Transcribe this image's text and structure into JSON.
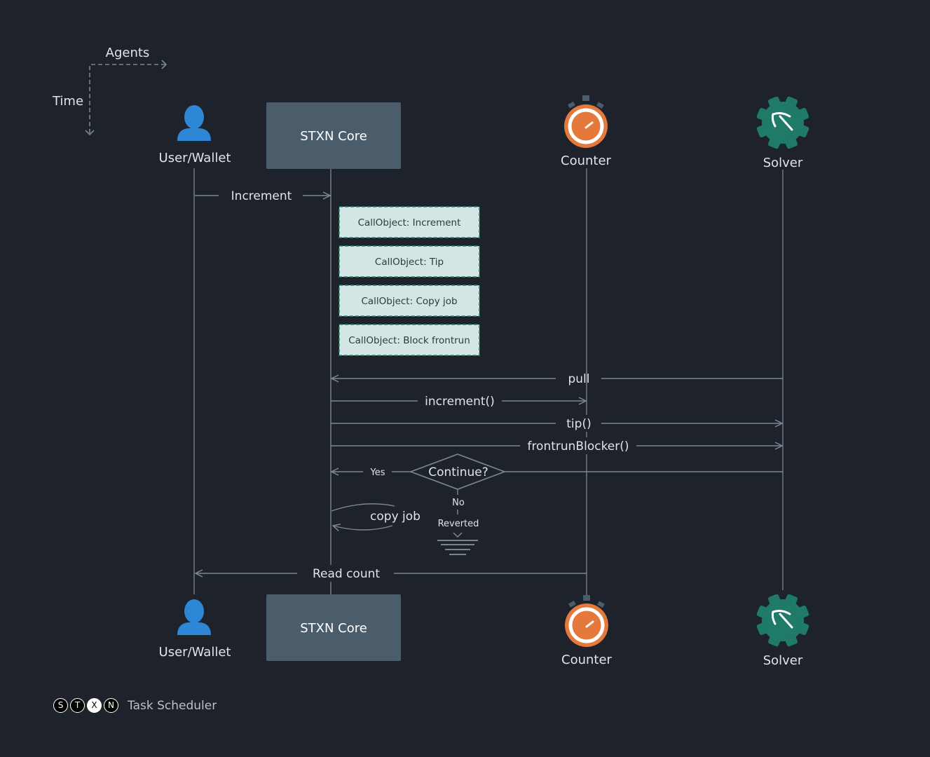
{
  "axes": {
    "horizontal_label": "Agents",
    "vertical_label": "Time"
  },
  "actors": {
    "user": "User/Wallet",
    "core": "STXN Core",
    "counter": "Counter",
    "solver": "Solver"
  },
  "call_objects": [
    "CallObject: Increment",
    "CallObject: Tip",
    "CallObject: Copy job",
    "CallObject: Block frontrun"
  ],
  "messages": {
    "increment": "Increment",
    "pull": "pull",
    "increment_call": "increment()",
    "tip_call": "tip()",
    "frontrun_call": "frontrunBlocker()",
    "decision": "Continue?",
    "yes": "Yes",
    "no": "No",
    "reverted": "Reverted",
    "copy_job": "copy job",
    "read_count": "Read count"
  },
  "footer": {
    "logo_letters": [
      "S",
      "T",
      "X",
      "N"
    ],
    "title": "Task Scheduler"
  },
  "colors": {
    "background": "#1e232b",
    "user_icon": "#2e86d6",
    "core_box": "#4b5c6b",
    "counter_orange": "#e5793b",
    "solver_green": "#1f7a68",
    "call_object_fill": "#d3e6e3",
    "call_object_border": "#2a8a72"
  }
}
